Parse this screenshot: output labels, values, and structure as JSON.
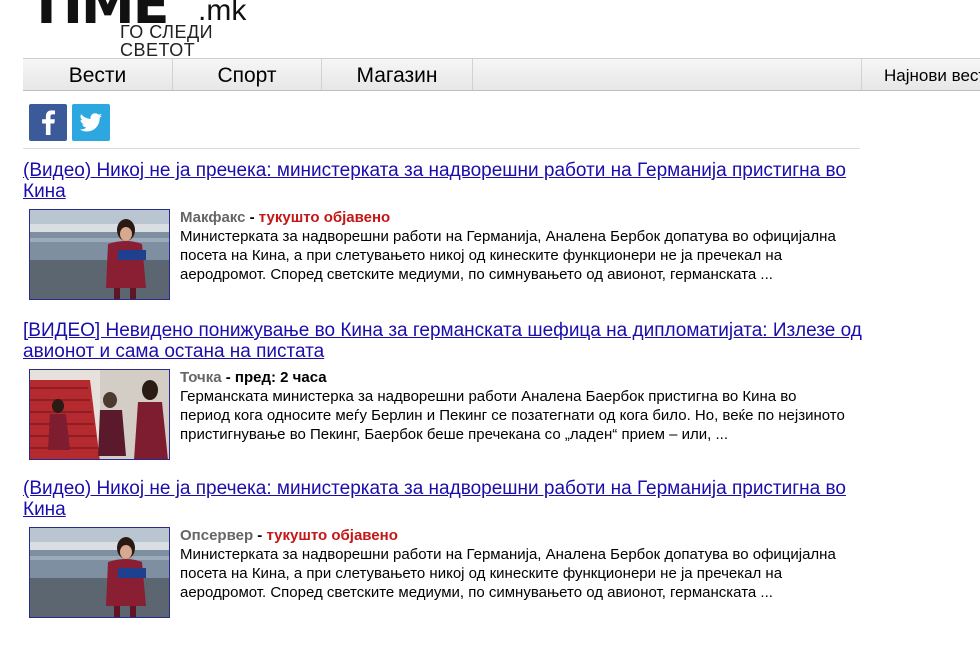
{
  "site": {
    "logo_main": "TIME",
    "logo_suffix": ".mk",
    "tagline": "ГО СЛЕДИ СВЕТОТ"
  },
  "nav": {
    "items": [
      {
        "label": "Вести"
      },
      {
        "label": "Спорт"
      },
      {
        "label": "Магазин"
      }
    ],
    "latest_label": "Најнови вести"
  },
  "share": {
    "facebook_icon": "facebook-icon",
    "twitter_icon": "twitter-icon",
    "facebook_color": "#3b5a9a",
    "twitter_color": "#2ca7e0"
  },
  "articles": [
    {
      "title": "(Видео) Никој не ја пречека: министерката за надворешни работи на Германија пристигна во Кина",
      "source": "Макфакс",
      "separator": " - ",
      "time": "тукушто објавено",
      "summary": "Министерката за надворешни работи на Германија, Аналена Бербок допатува во официјална посета на Кина, а при слетувањето никој од кинеските функционери не ја пречекал на аеродромот. Според светските медиуми, по симнувањето од авионот, германската ..."
    },
    {
      "title": "[ВИДЕО] Невидено понижување во Кина за германската шефица на дипломатијата: Излезе од авионот и сама остана на пистата",
      "source": "Точка",
      "separator": " - ",
      "time": "пред: 2 часа",
      "summary": "Германската министерка за надворешни работи Аналена Баербок пристигна во Кина во период кога односите меѓу Берлин и Пекинг се позатегнати од кога било. Но, веќе по нејзиното пристигнување во Пекинг, Баербок беше пречекана со „ладен“ прием – или, ..."
    },
    {
      "title": "(Видео) Никој не ја пречека: министерката за надворешни работи на Германија пристигна во Кина",
      "source": "Опсервер",
      "separator": " - ",
      "time": "тукушто објавено",
      "summary": "Министерката за надворешни работи на Германија, Аналена Бербок допатува во официјална посета на Кина, а при слетувањето никој од кинеските функционери не ја пречекал на аеродромот. Според светските медиуми, по симнувањето од авионот, германската ..."
    }
  ],
  "colors": {
    "link": "#1a0dab",
    "time_recent": "#c41616",
    "source": "#666666"
  }
}
